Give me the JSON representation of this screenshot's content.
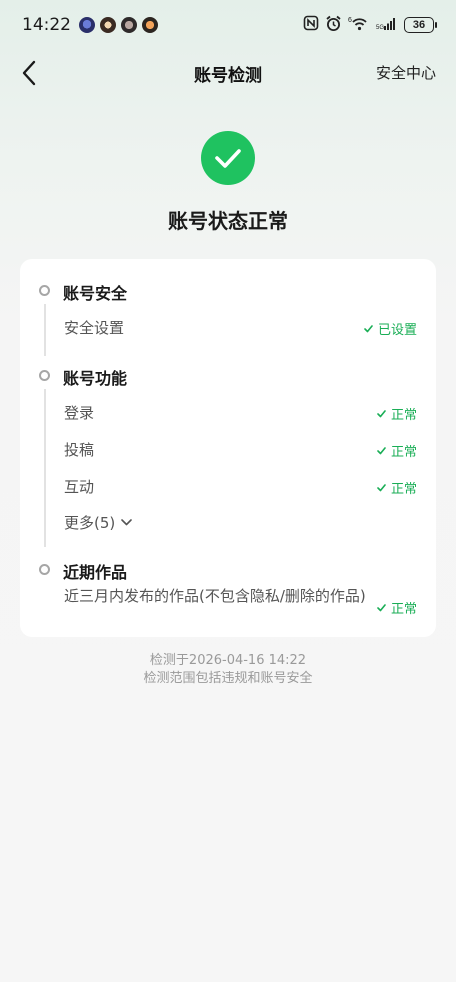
{
  "status_bar": {
    "time": "14:22",
    "battery": "36"
  },
  "nav": {
    "title": "账号检测",
    "right_link": "安全中心"
  },
  "hero": {
    "status_text": "账号状态正常",
    "accent": "#1fc260"
  },
  "sections": {
    "account_security": {
      "title": "账号安全",
      "items": [
        {
          "label": "安全设置",
          "status": "已设置"
        }
      ]
    },
    "account_function": {
      "title": "账号功能",
      "items": [
        {
          "label": "登录",
          "status": "正常"
        },
        {
          "label": "投稿",
          "status": "正常"
        },
        {
          "label": "互动",
          "status": "正常"
        }
      ],
      "more": "更多(5)"
    },
    "recent_works": {
      "title": "近期作品",
      "description": "近三月内发布的作品(不包含隐私/删除的作品)",
      "status": "正常"
    }
  },
  "footer": {
    "checked_at": "检测于2026-04-16 14:22",
    "scope": "检测范围包括违规和账号安全"
  },
  "colors": {
    "ok_green": "#1aae56"
  }
}
